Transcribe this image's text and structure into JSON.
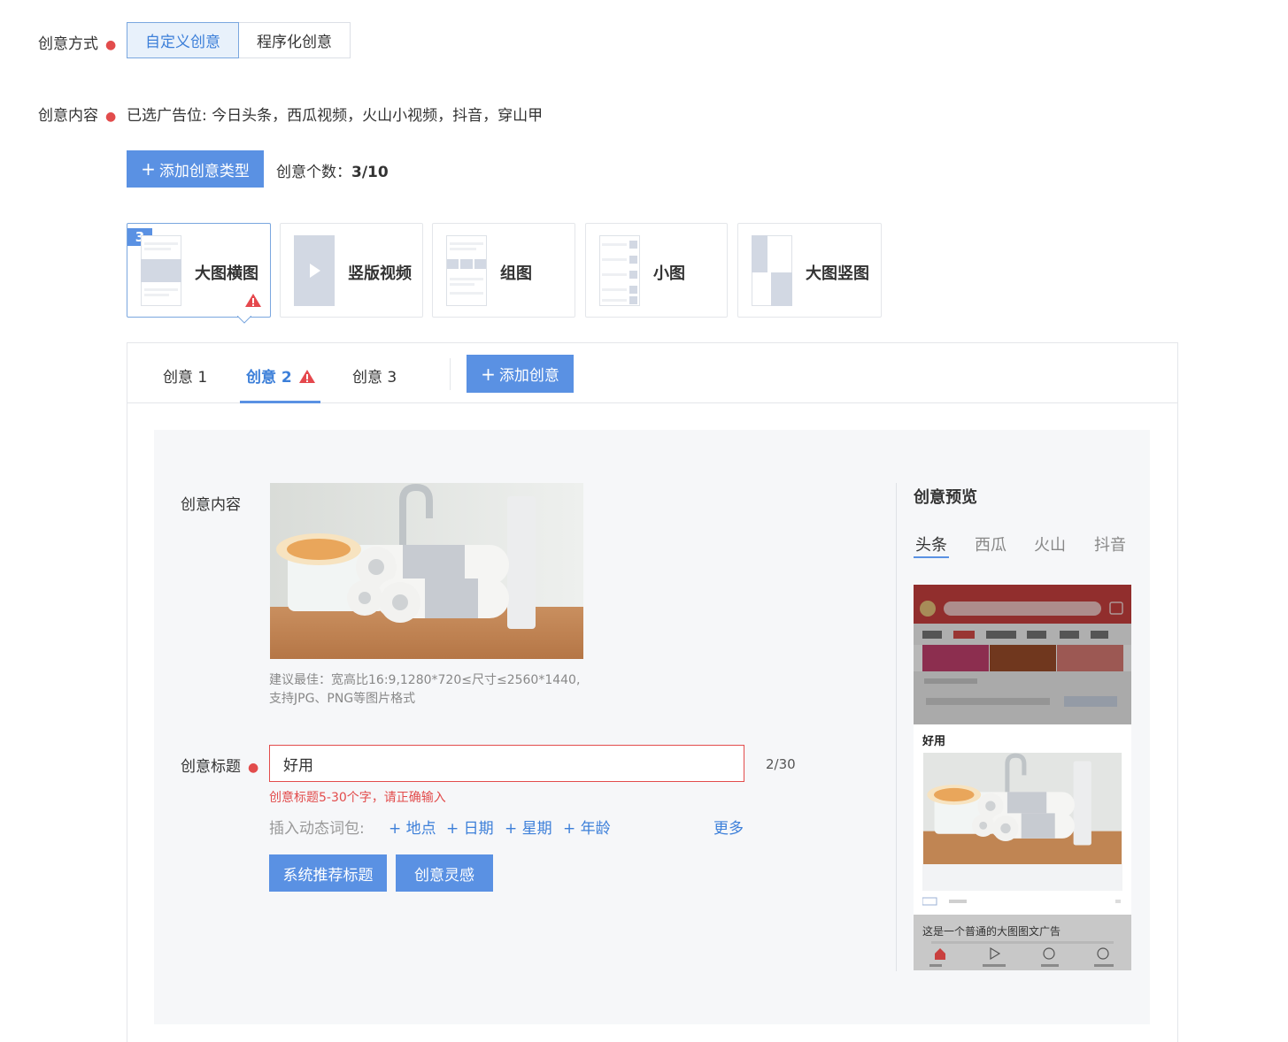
{
  "mode": {
    "label": "创意方式",
    "options": [
      "自定义创意",
      "程序化创意"
    ],
    "selected": 0
  },
  "content": {
    "label": "创意内容",
    "selected_slots_prefix": "已选广告位:",
    "selected_slots": "今日头条，西瓜视频，火山小视频，抖音，穿山甲",
    "add_type_button": "添加创意类型",
    "count_label": "创意个数：",
    "count_value": "3/10"
  },
  "types": [
    {
      "name": "大图横图",
      "badge": "3",
      "warning": true
    },
    {
      "name": "竖版视频"
    },
    {
      "name": "组图"
    },
    {
      "name": "小图"
    },
    {
      "name": "大图竖图"
    }
  ],
  "tabs": {
    "items": [
      "创意 1",
      "创意 2",
      "创意 3"
    ],
    "active": 1,
    "add_button": "添加创意"
  },
  "editor": {
    "content_label": "创意内容",
    "image_hint_1": "建议最佳：宽高比16:9,1280*720≤尺寸≤2560*1440,",
    "image_hint_2": "支持JPG、PNG等图片格式",
    "title_label": "创意标题",
    "title_value": "好用",
    "title_count": "2/30",
    "title_error": "创意标题5-30个字，请正确输入",
    "dynamic_label": "插入动态词包:",
    "dynamic_words": [
      "+ 地点",
      "+ 日期",
      "+ 星期",
      "+ 年龄"
    ],
    "more": "更多",
    "recommend_button": "系统推荐标题",
    "inspiration_button": "创意灵感"
  },
  "preview": {
    "title": "创意预览",
    "tabs": [
      "头条",
      "西瓜",
      "火山",
      "抖音"
    ],
    "active": 0,
    "ad_title": "好用",
    "bottom_text": "这是一个普通的大图图文广告"
  },
  "colors": {
    "accent": "#5a91e3",
    "error": "#e24c4c",
    "warning": "#e5484d"
  }
}
